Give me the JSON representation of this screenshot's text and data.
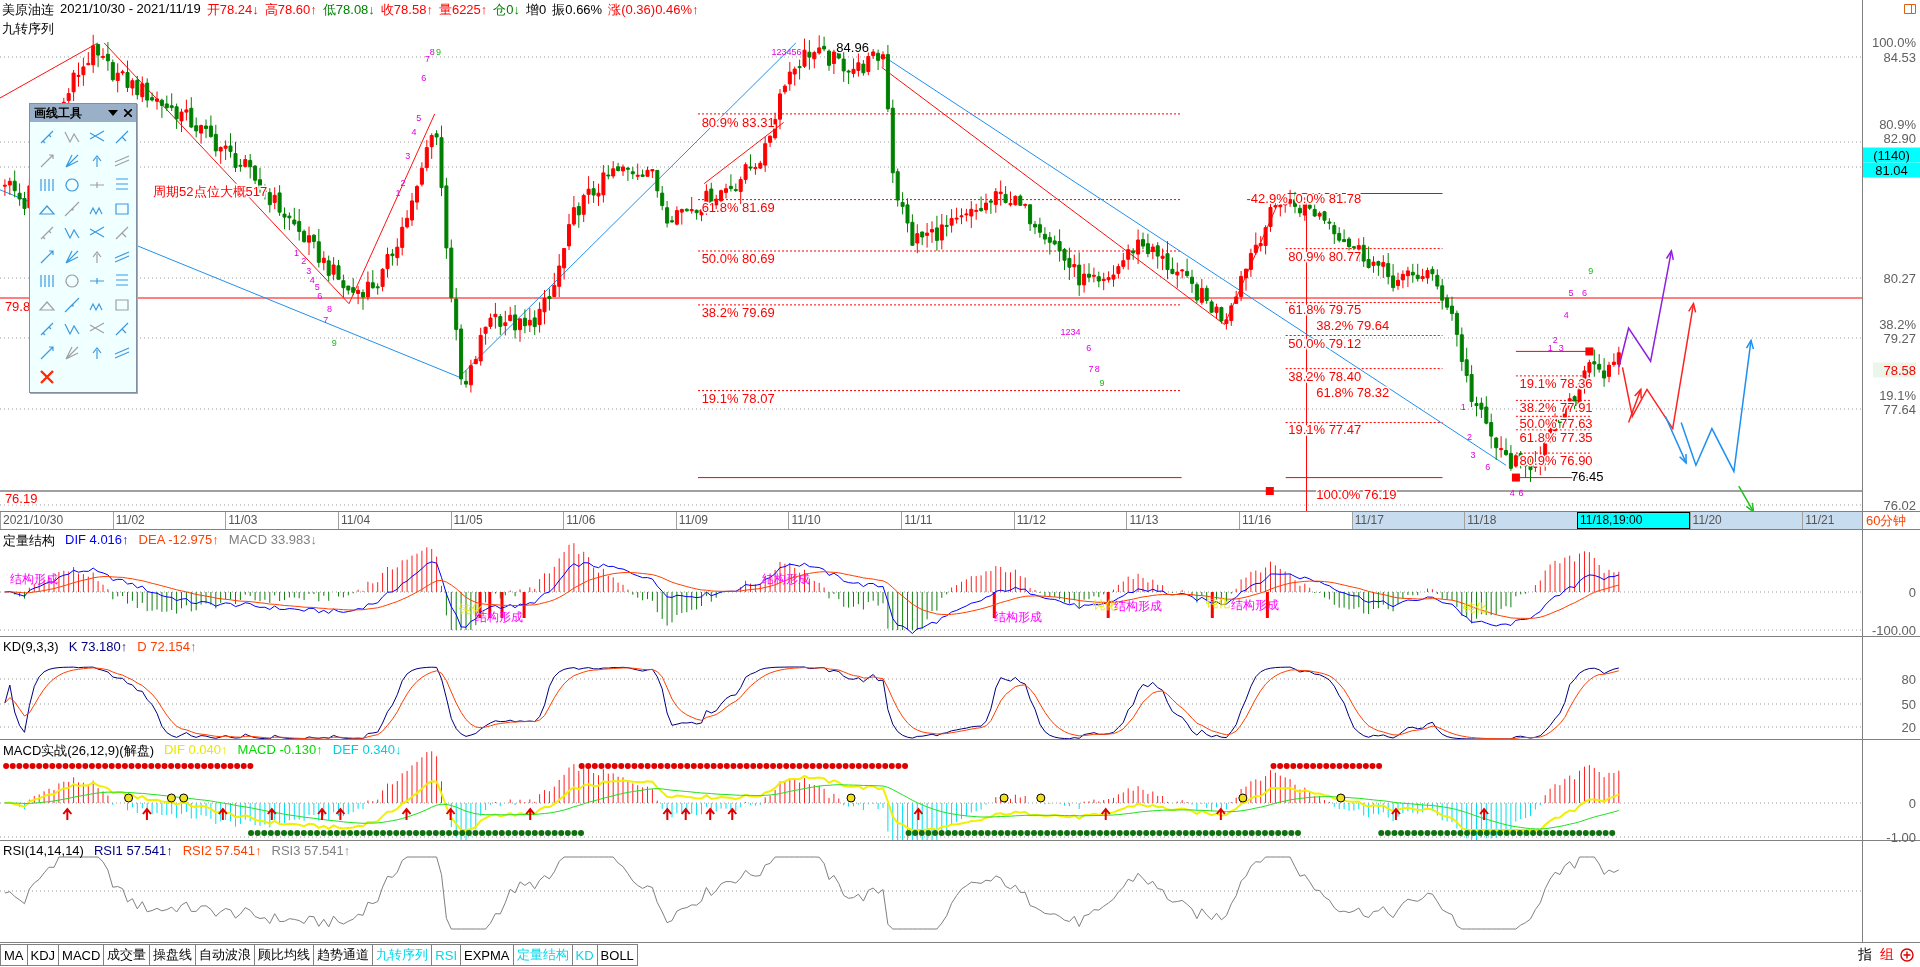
{
  "header": {
    "instrument": "美原油连",
    "date_range": "2021/10/30 - 2021/11/19",
    "indicator": "九转序列",
    "quotes": [
      {
        "text": "开78.24↓",
        "color": "#ff0000"
      },
      {
        "text": "高78.60↑",
        "color": "#ff0000"
      },
      {
        "text": "低78.08↓",
        "color": "#008000"
      },
      {
        "text": "收78.58↑",
        "color": "#ff0000"
      },
      {
        "text": "量6225↑",
        "color": "#ff0000"
      },
      {
        "text": "仓0↓",
        "color": "#008000"
      },
      {
        "text": "增0"
      },
      {
        "text": "振0.66%"
      },
      {
        "text": "涨(0.36)0.46%↑",
        "color": "#ff0000"
      }
    ]
  },
  "toolbox": {
    "title": "画线工具"
  },
  "chart": {
    "annotations": [
      {
        "text": "84.96",
        "kind": "extreme"
      },
      {
        "text": "80.9% 83.31",
        "kind": "level"
      },
      {
        "text": "61.8% 81.69",
        "kind": "level"
      },
      {
        "text": "50.0% 80.69",
        "kind": "level"
      },
      {
        "text": "38.2% 79.69",
        "kind": "level"
      },
      {
        "text": "19.1% 78.07",
        "kind": "level"
      },
      {
        "text": "周期52点位大概517",
        "kind": "level"
      },
      {
        "text": "-42.9%",
        "kind": "level"
      },
      {
        "text": "0.0% 81.78",
        "kind": "level"
      },
      {
        "text": "80.9% 80.77",
        "kind": "level"
      },
      {
        "text": "61.8% 79.75",
        "kind": "level"
      },
      {
        "text": "38.2% 79.64",
        "kind": "level"
      },
      {
        "text": "50.0% 79.12",
        "kind": "level"
      },
      {
        "text": "38.2% 78.40",
        "kind": "level"
      },
      {
        "text": "61.8% 78.32",
        "kind": "level"
      },
      {
        "text": "19.1% 77.47",
        "kind": "level"
      },
      {
        "text": "100.0% 76.19",
        "kind": "level"
      },
      {
        "text": "19.1% 78.36",
        "kind": "level"
      },
      {
        "text": "38.2% 77.91",
        "kind": "level"
      },
      {
        "text": "50.0% 77.63",
        "kind": "level"
      },
      {
        "text": "61.8% 77.35",
        "kind": "level"
      },
      {
        "text": "80.9% 76.90",
        "kind": "level"
      },
      {
        "text": "76.45",
        "kind": "extreme"
      },
      {
        "text": "79.8",
        "kind": "level"
      },
      {
        "text": "76.19",
        "kind": "level"
      }
    ],
    "sequence_marks": [
      {
        "text": "1",
        "kind": "setup"
      },
      {
        "text": "2",
        "kind": "setup"
      },
      {
        "text": "3",
        "kind": "setup"
      },
      {
        "text": "4",
        "kind": "setup"
      },
      {
        "text": "5",
        "kind": "setup"
      },
      {
        "text": "6",
        "kind": "setup"
      },
      {
        "text": "7",
        "kind": "setup"
      },
      {
        "text": "8",
        "kind": "setup"
      },
      {
        "text": "9",
        "kind": "complete"
      },
      {
        "text": "1",
        "kind": "setup"
      },
      {
        "text": "2",
        "kind": "setup"
      },
      {
        "text": "3",
        "kind": "setup"
      },
      {
        "text": "4",
        "kind": "setup"
      },
      {
        "text": "5",
        "kind": "setup"
      },
      {
        "text": "6",
        "kind": "setup"
      },
      {
        "text": "7",
        "kind": "setup"
      },
      {
        "text": "8",
        "kind": "setup"
      },
      {
        "text": "9",
        "kind": "complete"
      },
      {
        "text": "123456",
        "kind": "setup"
      },
      {
        "text": "1234",
        "kind": "setup"
      },
      {
        "text": "6",
        "kind": "setup"
      },
      {
        "text": "7",
        "kind": "setup"
      },
      {
        "text": "8",
        "kind": "setup"
      },
      {
        "text": "9",
        "kind": "complete"
      },
      {
        "text": "1",
        "kind": "setup"
      },
      {
        "text": "2",
        "kind": "setup"
      },
      {
        "text": "3",
        "kind": "setup"
      },
      {
        "text": "6",
        "kind": "setup"
      },
      {
        "text": "4",
        "kind": "setup"
      },
      {
        "text": "6",
        "kind": "setup"
      },
      {
        "text": "1",
        "kind": "setup"
      },
      {
        "text": "2",
        "kind": "setup"
      },
      {
        "text": "3",
        "kind": "setup"
      },
      {
        "text": "4",
        "kind": "setup"
      },
      {
        "text": "5",
        "kind": "setup"
      },
      {
        "text": "6",
        "kind": "setup"
      },
      {
        "text": "9",
        "kind": "complete"
      }
    ]
  },
  "price_axis": [
    {
      "text": "100.0%",
      "kind": "tick"
    },
    {
      "text": "84.53",
      "kind": "tick"
    },
    {
      "text": "80.9%",
      "kind": "tick"
    },
    {
      "text": "82.90",
      "kind": "tick"
    },
    {
      "text": "(1140)",
      "kind": "cursor"
    },
    {
      "text": "81.04",
      "kind": "cursor"
    },
    {
      "text": "80.27",
      "kind": "tick"
    },
    {
      "text": "38.2%",
      "kind": "tick"
    },
    {
      "text": "79.27",
      "kind": "tick"
    },
    {
      "text": "78.58",
      "kind": "current"
    },
    {
      "text": "19.1%",
      "kind": "tick"
    },
    {
      "text": "77.64",
      "kind": "tick"
    },
    {
      "text": "76.02",
      "kind": "tick"
    }
  ],
  "date_axis": {
    "period": "60分钟",
    "dates": [
      {
        "text": "2021/10/30",
        "kind": "date",
        "selected": false
      },
      {
        "text": "11/02",
        "kind": "date",
        "selected": false
      },
      {
        "text": "11/03",
        "kind": "date",
        "selected": false
      },
      {
        "text": "11/04",
        "kind": "date",
        "selected": false
      },
      {
        "text": "11/05",
        "kind": "date",
        "selected": false
      },
      {
        "text": "11/06",
        "kind": "date",
        "selected": false
      },
      {
        "text": "11/09",
        "kind": "date",
        "selected": false
      },
      {
        "text": "11/10",
        "kind": "date",
        "selected": false
      },
      {
        "text": "11/11",
        "kind": "date",
        "selected": false
      },
      {
        "text": "11/12",
        "kind": "date",
        "selected": false
      },
      {
        "text": "11/13",
        "kind": "date",
        "selected": false
      },
      {
        "text": "11/16",
        "kind": "date",
        "selected": false
      },
      {
        "text": "11/17",
        "kind": "date",
        "selected": true
      },
      {
        "text": "11/18",
        "kind": "date",
        "selected": true
      },
      {
        "text": "11/18,19:00",
        "kind": "cursor"
      },
      {
        "text": "11/20",
        "kind": "date",
        "selected": true
      },
      {
        "text": "11/21",
        "kind": "date",
        "selected": true
      }
    ]
  },
  "indicators": [
    {
      "kind": "structure",
      "title": "定量结构",
      "readings": [
        {
          "text": "DIF 4.016↑",
          "color": "#0000ff"
        },
        {
          "text": "DEA -12.975↑",
          "color": "#ff4000"
        },
        {
          "text": "MACD 33.983↓",
          "color": "#808080"
        }
      ],
      "axis": [
        "0",
        "-100.00"
      ],
      "annotations": [
        {
          "text": "结构形成",
          "kind": "structure"
        },
        {
          "text": "钝化",
          "kind": "blunt"
        },
        {
          "text": "结构形成",
          "kind": "structure"
        },
        {
          "text": "结构形成",
          "kind": "structure"
        },
        {
          "text": "结构形成",
          "kind": "structure"
        },
        {
          "text": "钝化",
          "kind": "blunt"
        },
        {
          "text": "结构形成",
          "kind": "structure"
        },
        {
          "text": "钝化",
          "kind": "blunt"
        },
        {
          "text": "结构形成",
          "kind": "structure"
        },
        {
          "text": "钝化",
          "kind": "blunt"
        }
      ]
    },
    {
      "kind": "kd",
      "title": "KD(9,3,3)",
      "readings": [
        {
          "text": "K 73.180↑",
          "color": "#000080"
        },
        {
          "text": "D 72.154↑",
          "color": "#ff4000"
        }
      ],
      "axis": [
        "80",
        "50",
        "20"
      ]
    },
    {
      "kind": "macd_signal",
      "title": "MACD实战(26,12,9)(解盘)",
      "readings": [
        {
          "text": "DIF 0.040↑",
          "color": "#e8e800"
        },
        {
          "text": "MACD -0.130↑",
          "color": "#00dd00"
        },
        {
          "text": "DEF 0.340↓",
          "color": "#00d0e0"
        }
      ],
      "axis": [
        "0",
        "-1.00"
      ]
    },
    {
      "kind": "rsi",
      "title": "RSI(14,14,14)",
      "readings": [
        {
          "text": "RSI1 57.541↑",
          "color": "#000080"
        },
        {
          "text": "RSI2 57.541↑",
          "color": "#ff4000"
        },
        {
          "text": "RSI3 57.541↑",
          "color": "#808080"
        }
      ]
    }
  ],
  "tabs": [
    {
      "label": "MA",
      "selected": false
    },
    {
      "label": "KDJ",
      "selected": false
    },
    {
      "label": "MACD",
      "selected": false
    },
    {
      "label": "成交量",
      "selected": false
    },
    {
      "label": "操盘线",
      "selected": false
    },
    {
      "label": "自动波浪",
      "selected": false
    },
    {
      "label": "顾比均线",
      "selected": false
    },
    {
      "label": "趋势通道",
      "selected": false
    },
    {
      "label": "九转序列",
      "selected": true
    },
    {
      "label": "RSI",
      "selected": true
    },
    {
      "label": "EXPMA",
      "selected": false
    },
    {
      "label": "定量结构",
      "selected": true
    },
    {
      "label": "KD",
      "selected": true
    },
    {
      "label": "BOLL",
      "selected": false
    }
  ],
  "corner_buttons": [
    {
      "text": "指"
    },
    {
      "text": "组",
      "color": "#ff0000"
    }
  ]
}
